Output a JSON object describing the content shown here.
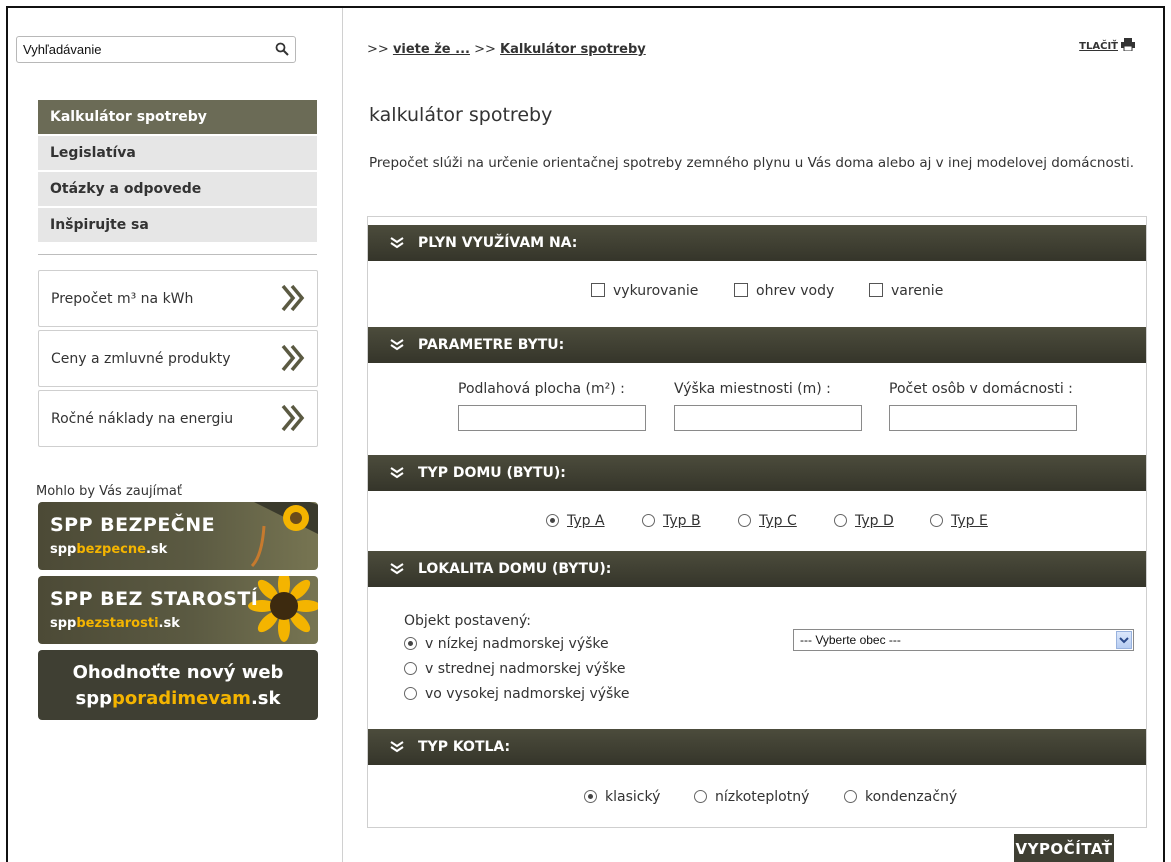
{
  "search": {
    "value": "Vyhľadávanie"
  },
  "menu": [
    {
      "label": "Kalkulátor spotreby",
      "active": true
    },
    {
      "label": "Legislatíva",
      "active": false
    },
    {
      "label": "Otázky a odpovede",
      "active": false
    },
    {
      "label": "Inšpirujte sa",
      "active": false
    }
  ],
  "links": [
    {
      "label": "Prepočet m³ na kWh"
    },
    {
      "label": "Ceny a zmluvné produkty"
    },
    {
      "label": "Ročné náklady na energiu"
    }
  ],
  "interest_label": "Mohlo by Vás zaujímať",
  "banners": [
    {
      "title": "SPP BEZPEČNE",
      "domain_pre": "spp",
      "domain_hl": "bezpecne",
      "domain_post": ".sk"
    },
    {
      "title": "SPP BEZ STAROSTÍ",
      "domain_pre": "spp",
      "domain_hl": "bezstarosti",
      "domain_post": ".sk"
    },
    {
      "line1": "Ohodnoťte nový web",
      "domain_pre": "spp",
      "domain_hl": "poradimevam",
      "domain_post": ".sk"
    }
  ],
  "breadcrumb": {
    "sep": ">>",
    "item1": "viete že ...",
    "item2": "Kalkulátor spotreby"
  },
  "print_label": "TLAČIŤ",
  "page_title": "kalkulátor spotreby",
  "intro": "Prepočet slúži na určenie orientačnej spotreby zemného plynu u Vás doma alebo aj v inej modelovej domácnosti.",
  "sections": {
    "usage": {
      "title": "PLYN VYUŽÍVAM NA:",
      "options": [
        "vykurovanie",
        "ohrev vody",
        "varenie"
      ]
    },
    "params": {
      "title": "PARAMETRE BYTU:",
      "fields": [
        "Podlahová plocha (m²) :",
        "Výška miestnosti (m) :",
        "Počet osôb v domácnosti :"
      ]
    },
    "house_type": {
      "title": "TYP DOMU (BYTU):",
      "options": [
        "Typ A",
        "Typ B",
        "Typ C",
        "Typ D",
        "Typ E"
      ],
      "selected": "Typ A"
    },
    "location": {
      "title": "LOKALITA DOMU (BYTU):",
      "built_label": "Objekt postavený:",
      "options": [
        "v nízkej nadmorskej výške",
        "v strednej nadmorskej výške",
        "vo vysokej nadmorskej výške"
      ],
      "selected": "v nízkej nadmorskej výške",
      "select_value": "--- Vyberte obec ---"
    },
    "boiler": {
      "title": "TYP KOTLA:",
      "options": [
        "klasický",
        "nízkoteplotný",
        "kondenzačný"
      ],
      "selected": "klasický"
    }
  },
  "calc_button": "VYPOČÍTAŤ",
  "colors": {
    "header": "#3f3f33",
    "active_menu": "#6b6b56",
    "accent": "#f4b400"
  }
}
